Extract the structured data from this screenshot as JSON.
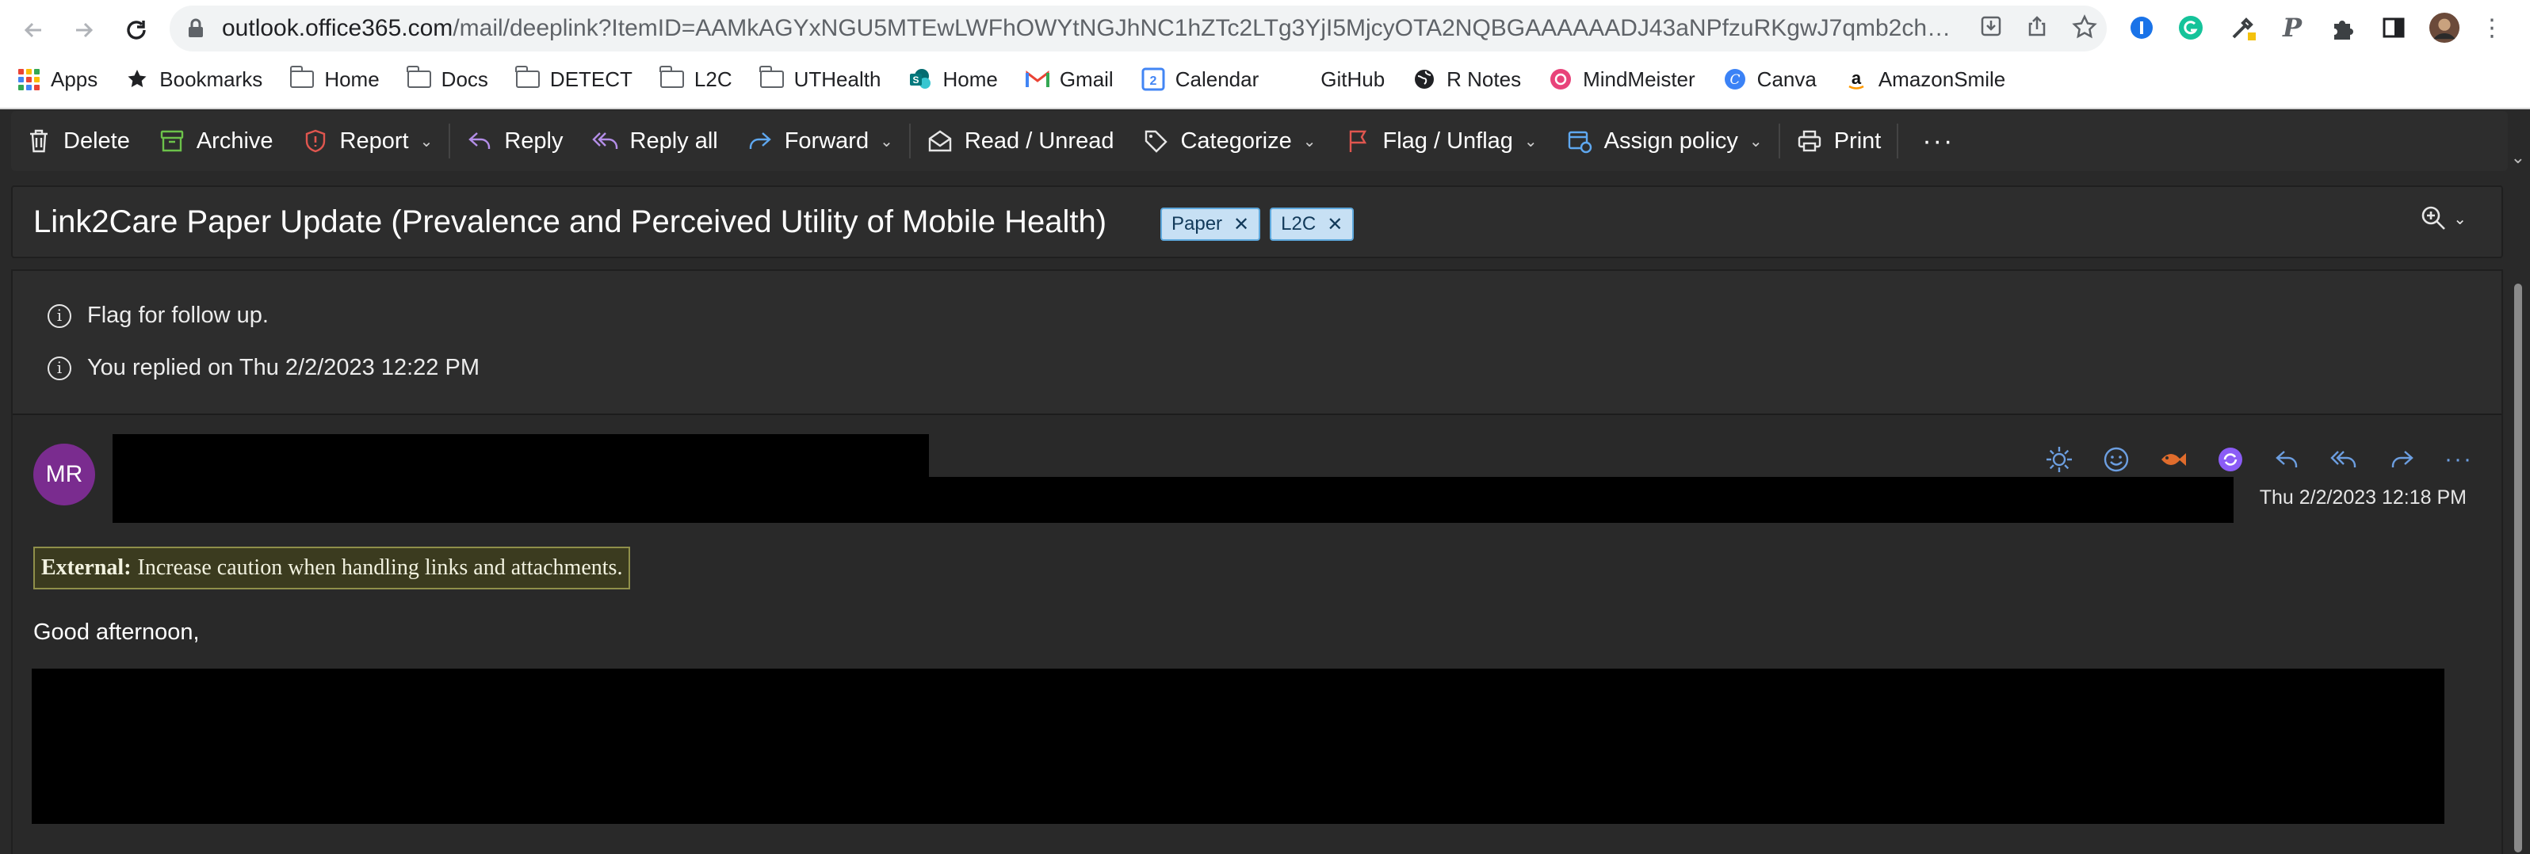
{
  "browser": {
    "url_host": "outlook.office365.com",
    "url_path": "/mail/deeplink?ItemID=AAMkAGYxNGU5MTEwLWFhOWYtNGJhNC1hZTc2LTg3YjI5MjcyOTA2NQBGAAAAAADJ43aNPfzuRKgwJ7qmb2chBwA...",
    "bookmarks": [
      {
        "label": "Apps",
        "icon": "apps-grid-icon"
      },
      {
        "label": "Bookmarks",
        "icon": "star-icon"
      },
      {
        "label": "Home",
        "icon": "folder-icon"
      },
      {
        "label": "Docs",
        "icon": "folder-icon"
      },
      {
        "label": "DETECT",
        "icon": "folder-icon"
      },
      {
        "label": "L2C",
        "icon": "folder-icon"
      },
      {
        "label": "UTHealth",
        "icon": "folder-icon"
      },
      {
        "label": "Home",
        "icon": "sharepoint-icon"
      },
      {
        "label": "Gmail",
        "icon": "gmail-icon"
      },
      {
        "label": "Calendar",
        "icon": "calendar-icon"
      },
      {
        "label": "GitHub",
        "icon": "github-icon"
      },
      {
        "label": "R Notes",
        "icon": "globe-icon"
      },
      {
        "label": "MindMeister",
        "icon": "mindmeister-icon"
      },
      {
        "label": "Canva",
        "icon": "canva-icon"
      },
      {
        "label": "AmazonSmile",
        "icon": "amazon-icon"
      }
    ],
    "calendar_icon_day": "2"
  },
  "toolbar": {
    "delete": "Delete",
    "archive": "Archive",
    "report": "Report",
    "reply": "Reply",
    "reply_all": "Reply all",
    "forward": "Forward",
    "read_unread": "Read / Unread",
    "categorize": "Categorize",
    "flag_unflag": "Flag / Unflag",
    "assign_policy": "Assign policy",
    "print": "Print",
    "more": "···"
  },
  "message": {
    "subject": "Link2Care Paper Update (Prevalence and Perceived Utility of Mobile Health)",
    "tags": [
      "Paper",
      "L2C"
    ],
    "info_flag": "Flag for follow up.",
    "info_replied": "You replied on Thu 2/2/2023 12:22 PM",
    "sender_initials": "MR",
    "date": "Thu 2/2/2023 12:18 PM",
    "external_label": "External:",
    "external_text": "Increase caution when handling links and attachments.",
    "greeting": "Good afternoon,"
  },
  "colors": {
    "accent": "#6c9ee0",
    "avatar_bg": "#7a2c8f",
    "tag_bg": "#c7e0f4",
    "report_icon": "#e0564f",
    "flag_icon": "#e0564f",
    "archive_icon": "#6cc24a"
  }
}
